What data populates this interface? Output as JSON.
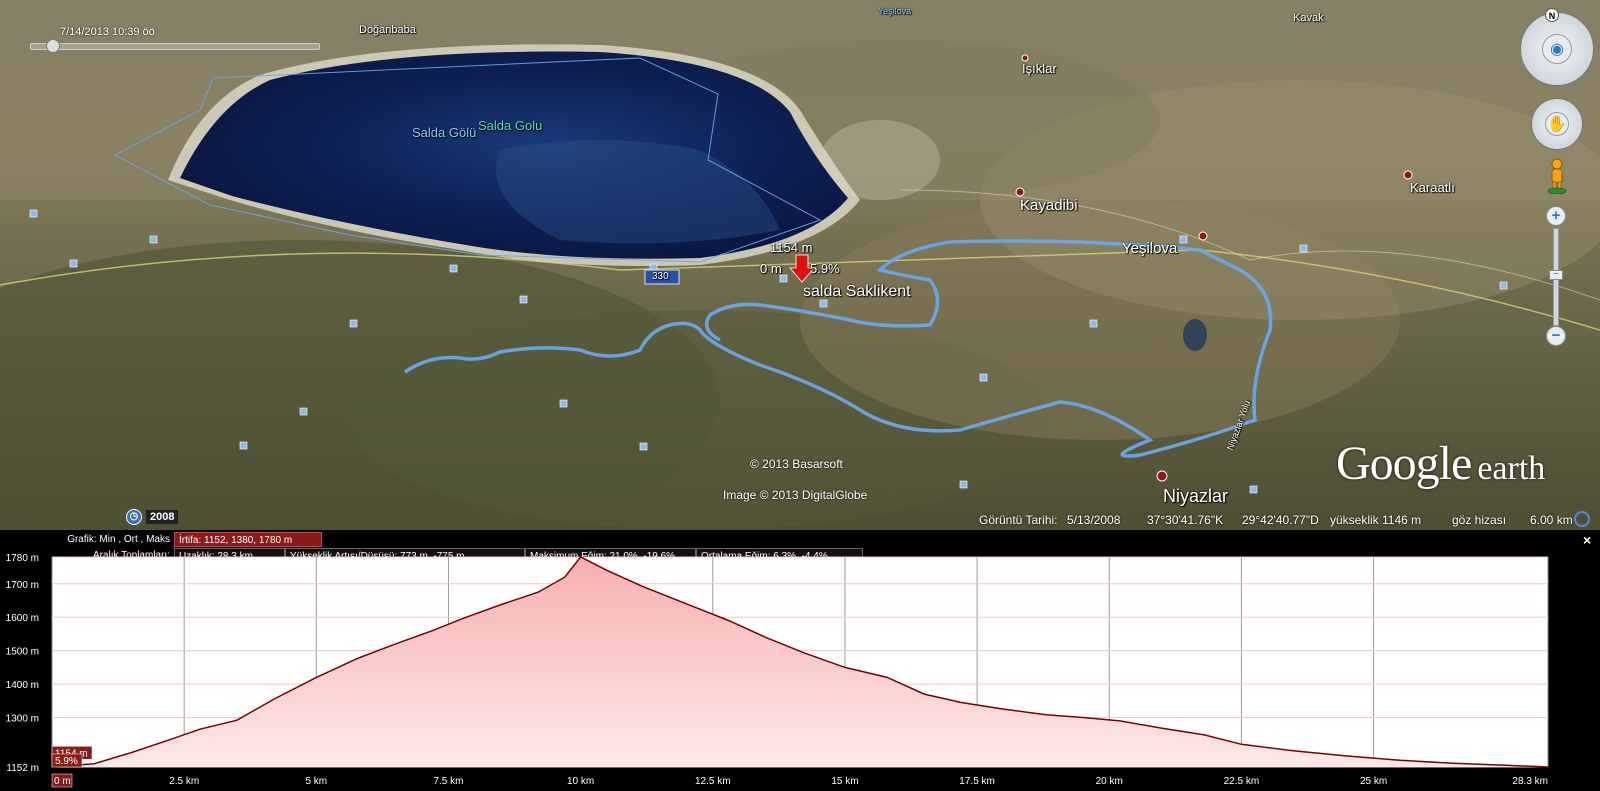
{
  "map": {
    "timestamp": "7/14/2013  10:39 öö",
    "historical_year": "2008",
    "places": {
      "doganbaba": "Doğanbaba",
      "yesilova_top": "Yeşilova",
      "kavak": "Kavak",
      "isiklar": "Işıklar",
      "salda_golu_1": "Salda Gölü",
      "salda_golu_2": "Salda Golu",
      "kayadibi": "Kayadibi",
      "yesilova": "Yeşilova",
      "karaatli": "Karaatlı",
      "salda_saklikent": "salda Saklikent",
      "niyazlar": "Niyazlar",
      "road_330": "330",
      "road_name": "Niyazlar Yolu"
    },
    "marker": {
      "elevation": "1154 m",
      "distance": "0 m",
      "slope": "5.9%"
    },
    "credits": {
      "basarsoft": "© 2013 Basarsoft",
      "digitalglobe": "Image © 2013 DigitalGlobe"
    },
    "status": {
      "imagery_date_label": "Görüntü Tarihi:",
      "imagery_date": "5/13/2008",
      "lat": "37°30'41.76\"K",
      "lon": "29°42'40.77\"D",
      "elevation": "yükseklik  1146 m",
      "eye_alt_label": "göz hizası",
      "eye_alt": "6.00 km"
    },
    "logo": {
      "google": "Google",
      "earth": "earth"
    },
    "nav": {
      "north": "N",
      "zoom_in": "+",
      "zoom_out": "−",
      "zoom_mid": "−"
    },
    "colors": {
      "track": "#6aa7e6",
      "lake": "#0d1f52"
    }
  },
  "profile": {
    "close": "×",
    "row1": {
      "label": "Grafik: Min , Ort , Maks",
      "value": "İrtifa: 1152, 1380, 1780 m"
    },
    "row2": {
      "label": "Aralık Toplamları:",
      "distance": "Uzaklık: 28.3 km",
      "gain_loss": "Yükseklik Artışı/Düşüşü: 773 m, -775 m",
      "max_slope": "Maksimum Eğim: 21.0%, -19.6%",
      "avg_slope": "Ortalama Eğim: 6.3%, -4.4%"
    },
    "cursor": {
      "elevation": "1154 m",
      "slope": "5.9%",
      "distance": "0 m"
    }
  },
  "chart_data": {
    "type": "area",
    "title": "",
    "xlabel": "",
    "ylabel": "",
    "xlim": [
      0,
      28.3
    ],
    "ylim": [
      1152,
      1780
    ],
    "y_ticks": [
      "1152 m",
      "1300 m",
      "1400 m",
      "1500 m",
      "1600 m",
      "1700 m",
      "1780 m"
    ],
    "y_tick_values": [
      1152,
      1300,
      1400,
      1500,
      1600,
      1700,
      1780
    ],
    "x_ticks": [
      "0 m",
      "2.5 km",
      "5 km",
      "7.5 km",
      "10 km",
      "12.5 km",
      "15 km",
      "17.5 km",
      "20 km",
      "22.5 km",
      "25 km",
      "28.3 km"
    ],
    "x_tick_values": [
      0,
      2.5,
      5,
      7.5,
      10,
      12.5,
      15,
      17.5,
      20,
      22.5,
      25,
      28.3
    ],
    "grid": true,
    "series": [
      {
        "color": "#7a0000",
        "x": [
          0,
          0.8,
          1.5,
          2.2,
          2.8,
          3.5,
          4.2,
          5.0,
          5.8,
          6.5,
          7.2,
          7.8,
          8.5,
          9.2,
          9.7,
          10.0,
          10.5,
          11.2,
          12.0,
          12.8,
          13.5,
          14.2,
          15.0,
          15.8,
          16.5,
          17.2,
          18.0,
          18.8,
          19.5,
          20.2,
          21.0,
          21.8,
          22.5,
          23.5,
          24.5,
          25.5,
          26.5,
          27.5,
          28.3
        ],
        "values": [
          1152,
          1162,
          1195,
          1232,
          1265,
          1292,
          1355,
          1420,
          1478,
          1520,
          1560,
          1598,
          1638,
          1675,
          1720,
          1780,
          1740,
          1690,
          1640,
          1590,
          1540,
          1495,
          1450,
          1420,
          1370,
          1345,
          1325,
          1308,
          1300,
          1290,
          1268,
          1248,
          1220,
          1200,
          1185,
          1172,
          1163,
          1157,
          1152
        ]
      }
    ]
  }
}
